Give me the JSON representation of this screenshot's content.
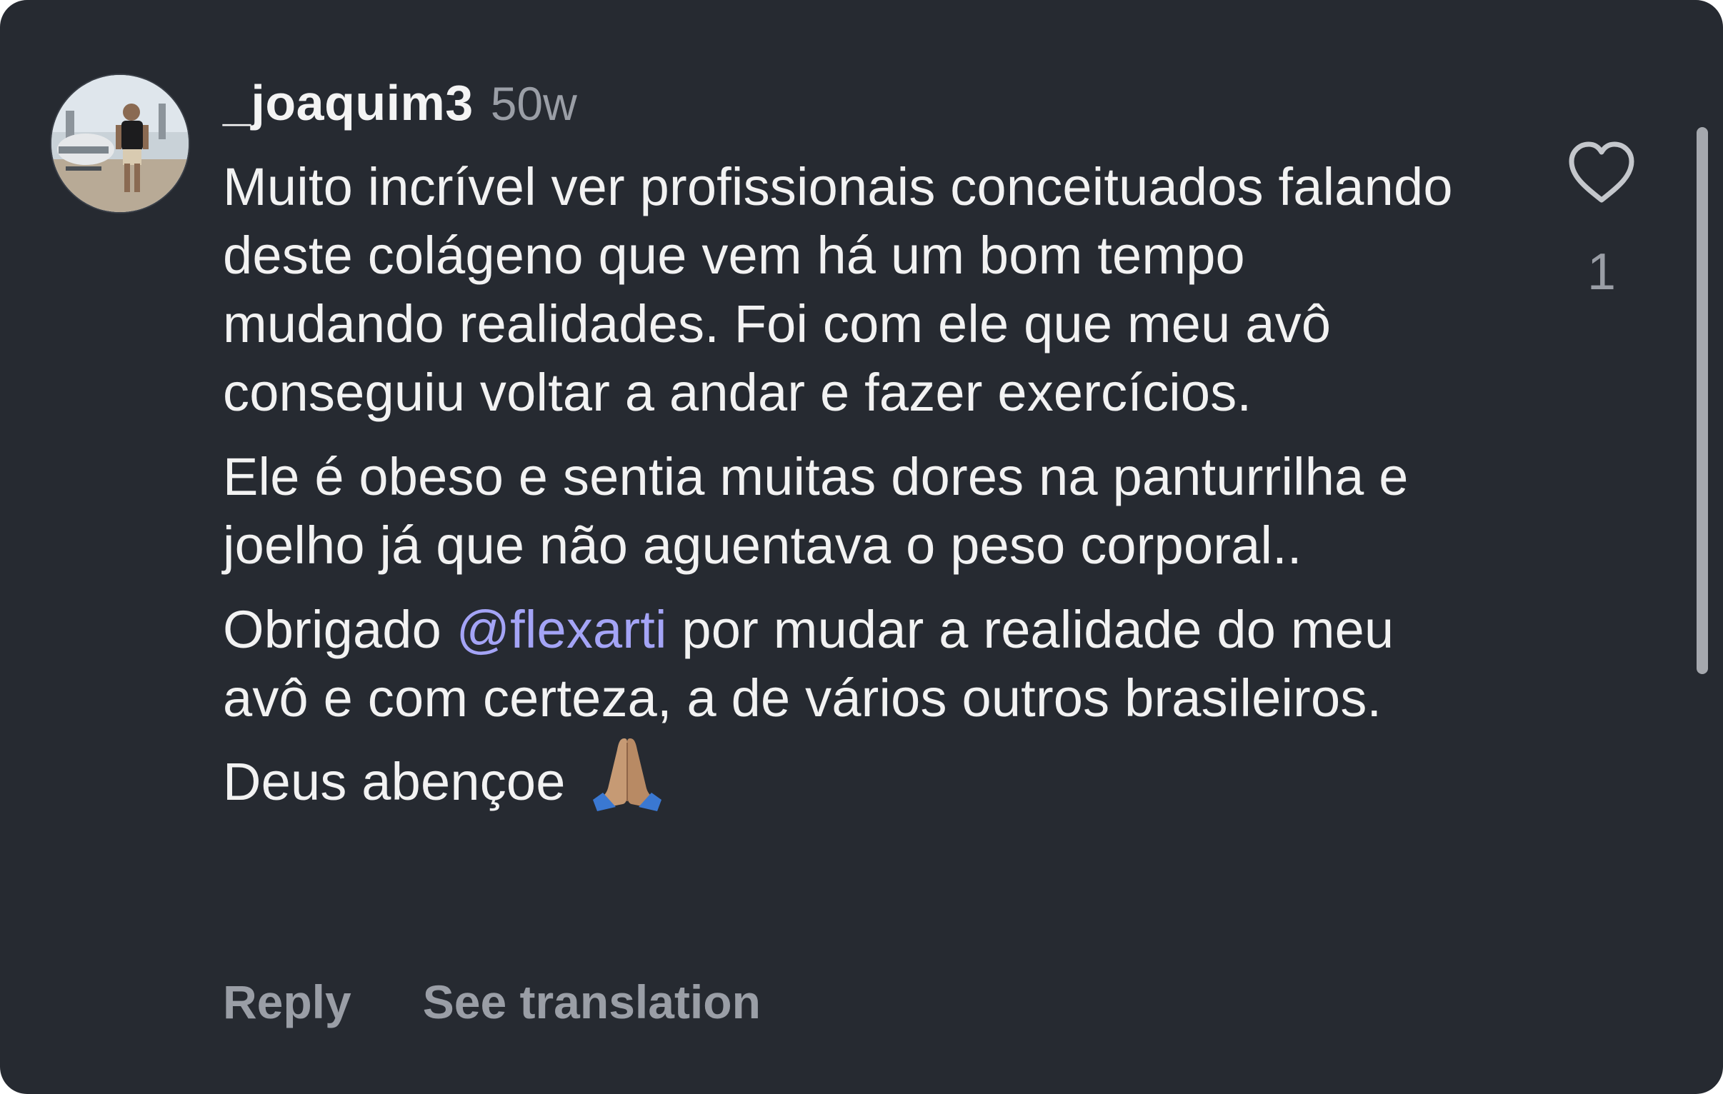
{
  "comment": {
    "username": "_joaquim3",
    "time": "50w",
    "paragraph1": "Muito incrível ver profissionais conceituados falando deste colágeno que vem há um bom tempo mudando realidades. Foi com ele que meu avô conseguiu voltar a andar e fazer exercícios.",
    "paragraph2": "Ele é obeso e sentia muitas dores na panturrilha e joelho já que não aguentava o peso corporal..",
    "paragraph3_before": "Obrigado ",
    "mention": "@flexarti",
    "paragraph3_after": " por mudar a realidade do meu avô e com certeza, a de vários outros brasileiros. Deus abençoe ",
    "emoji_icon": "praying-hands-icon",
    "like_count": "1",
    "like_icon": "heart-outline-icon",
    "avatar_icon": "profile-photo"
  },
  "actions": {
    "reply": "Reply",
    "see_translation": "See translation"
  },
  "colors": {
    "background": "#262a31",
    "text": "#f2f2f2",
    "muted": "#9a9ea6",
    "mention": "#a4a4f6"
  }
}
